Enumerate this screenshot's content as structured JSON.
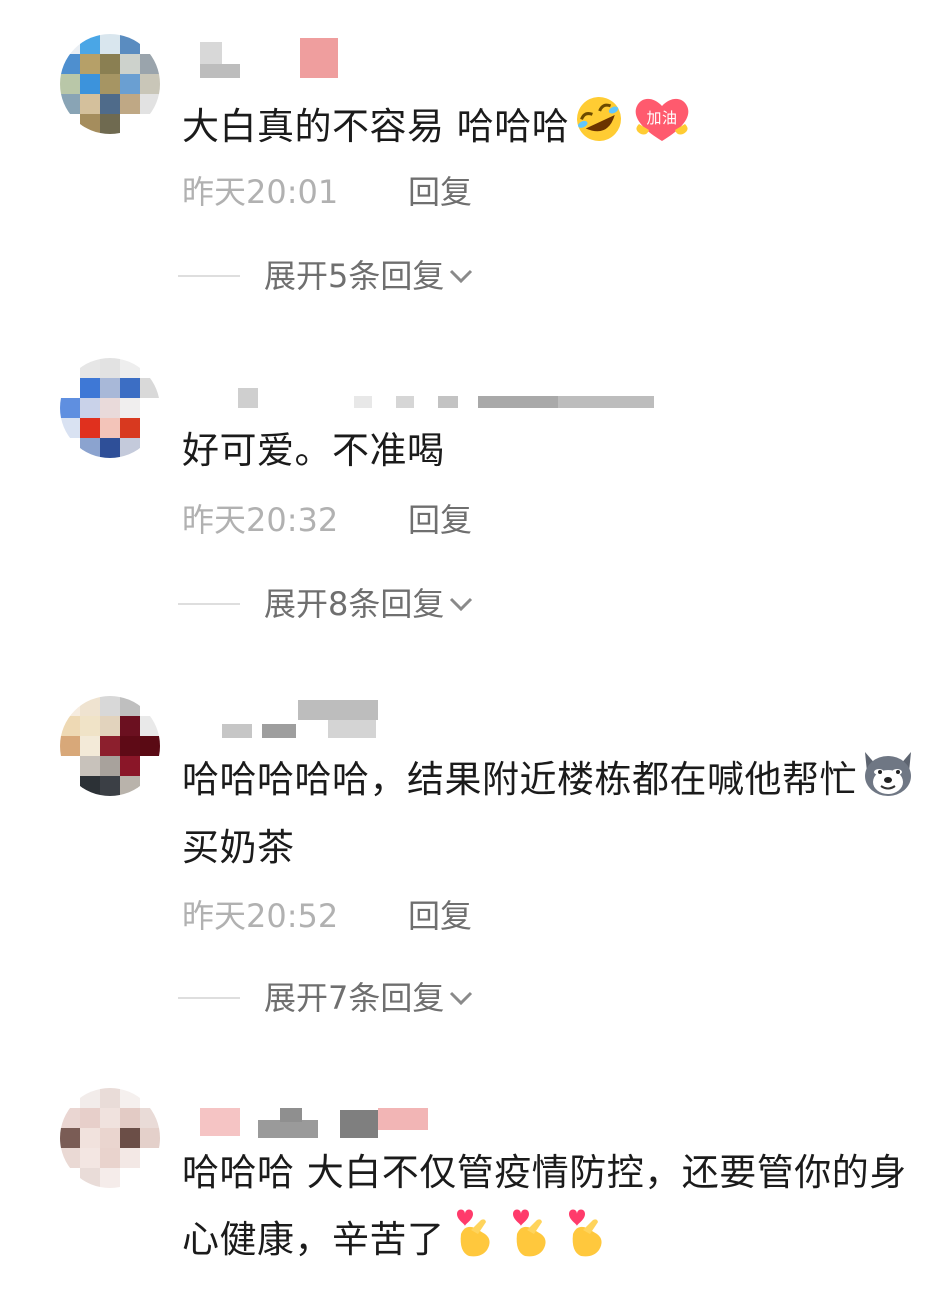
{
  "comments": [
    {
      "text_before": "大白真的不容易 哈哈哈",
      "emojis": [
        "rofl-emoji",
        "jiayou-heart-badge"
      ],
      "badge_text": "加油",
      "time": "昨天20:01",
      "reply_label": "回复",
      "expand_label": "展开5条回复"
    },
    {
      "text": "好可爱。不准喝",
      "time": "昨天20:32",
      "reply_label": "回复",
      "expand_label": "展开8条回复"
    },
    {
      "text_part1": "哈哈哈哈哈，结果附近楼栋都在喊他帮忙",
      "emoji": "doge-husky-emoji",
      "text_part2": "买奶茶",
      "time": "昨天20:52",
      "reply_label": "回复",
      "expand_label": "展开7条回复"
    },
    {
      "text": "哈哈哈 大白不仅管疫情防控，还要管你的身心健康，辛苦了",
      "emojis": [
        "finger-heart-emoji",
        "finger-heart-emoji",
        "finger-heart-emoji"
      ]
    }
  ],
  "colors": {
    "text": "#1b1b1b",
    "time": "#b1b1b1",
    "action": "#6f6f6f",
    "divider": "#dedede"
  }
}
